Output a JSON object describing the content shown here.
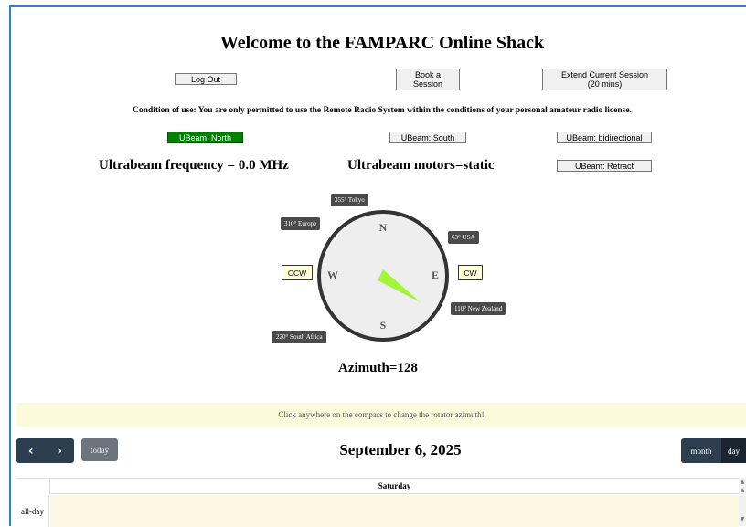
{
  "page": {
    "title": "Welcome to the FAMPARC Online Shack",
    "condition_text": "Condition of use: You are only permitted to use the Remote Radio System within the conditions of your personal amateur radio license."
  },
  "session_buttons": {
    "logout": "Log Out",
    "book_line1": "Book a",
    "book_line2": "Session",
    "extend_line1": "Extend Current Session",
    "extend_line2": "(20 mins)"
  },
  "ultrabeam": {
    "north": "UBeam: North",
    "south": "UBeam: South",
    "bidirectional": "UBeam: bidirectional",
    "retract": "UBeam: Retract",
    "frequency_text": "Ultrabeam frequency = 0.0 MHz",
    "motors_text": "Ultrabeam motors=static",
    "active_button": "north",
    "active_color": "#008000"
  },
  "compass": {
    "directions": {
      "n": "N",
      "e": "E",
      "s": "S",
      "w": "W"
    },
    "presets": {
      "tokyo": "355° Tokyo",
      "europe": "310° Europe",
      "usa": "63° USA",
      "new_zealand": "110° New Zealand",
      "south_africa": "220° South Africa"
    },
    "ccw": "CCW",
    "cw": "CW",
    "azimuth_text": "Azimuth=128",
    "azimuth_value": 128,
    "needle_color": "#a4f53a",
    "hint": "Click anywhere on the compass to change the rotator azimuth!"
  },
  "calendar": {
    "prev_icon": "‹",
    "next_icon": "›",
    "today": "today",
    "title": "September 6, 2025",
    "view_month": "month",
    "view_day": "day",
    "column_header": "Saturday",
    "allday_label": "all-day"
  }
}
